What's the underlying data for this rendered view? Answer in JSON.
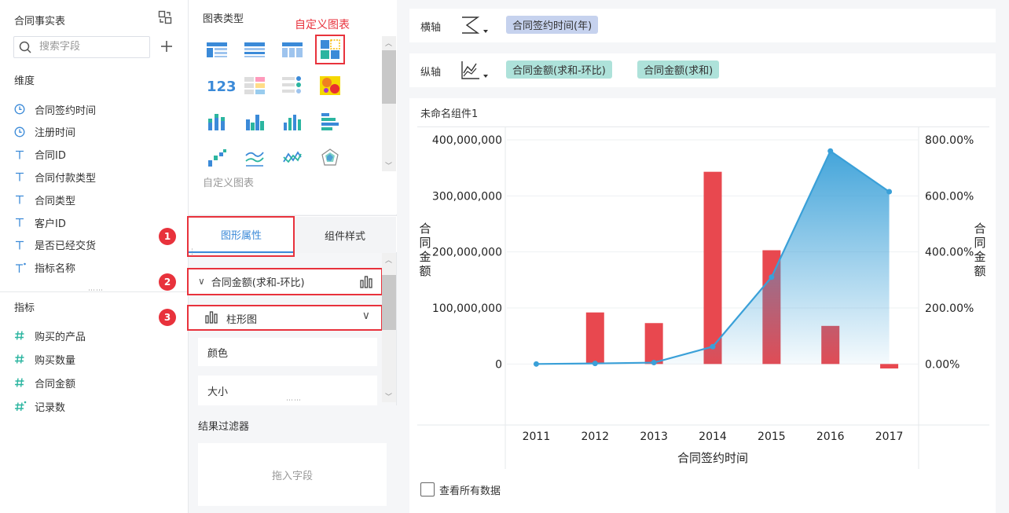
{
  "left_panel": {
    "dataset_title": "合同事实表",
    "search_placeholder": "搜索字段",
    "dimensions_label": "维度",
    "dimensions": [
      {
        "icon": "clock-icon",
        "label": "合同签约时间"
      },
      {
        "icon": "clock-icon",
        "label": "注册时间"
      },
      {
        "icon": "text-icon",
        "label": "合同ID"
      },
      {
        "icon": "text-icon",
        "label": "合同付款类型"
      },
      {
        "icon": "text-icon",
        "label": "合同类型"
      },
      {
        "icon": "text-icon",
        "label": "客户ID"
      },
      {
        "icon": "text-icon",
        "label": "是否已经交货"
      },
      {
        "icon": "text-calc-icon",
        "label": "指标名称"
      }
    ],
    "measures_label": "指标",
    "measures": [
      {
        "icon": "hash-icon",
        "label": "购买的产品"
      },
      {
        "icon": "hash-icon",
        "label": "购买数量"
      },
      {
        "icon": "hash-icon",
        "label": "合同金额"
      },
      {
        "icon": "hash-calc-icon",
        "label": "记录数"
      }
    ]
  },
  "middle_panel": {
    "chart_type_label": "图表类型",
    "custom_chart_callout": "自定义图表",
    "selected_footer": "自定义图表",
    "tabs": [
      {
        "label": "图形属性",
        "active": true
      },
      {
        "label": "组件样式",
        "active": false
      }
    ],
    "badges": [
      "1",
      "2",
      "3"
    ],
    "measure_row_label": "合同金额(求和-环比)",
    "chart_type_select": "柱形图",
    "props": [
      "颜色",
      "大小"
    ],
    "filter_title": "结果过滤器",
    "filter_placeholder": "拖入字段"
  },
  "axes": {
    "x_label": "横轴",
    "x_fields": [
      "合同签约时间(年)"
    ],
    "y_label": "纵轴",
    "y_fields": [
      "合同金额(求和-环比)",
      "合同金额(求和)"
    ]
  },
  "widget": {
    "title": "未命名组件1",
    "show_all_label": "查看所有数据"
  },
  "colors": {
    "bar": "#e8484f",
    "line": "#3aa0d8",
    "accent": "#3b8ad8",
    "highlight": "#e8323c"
  },
  "chart_data": {
    "type": "bar",
    "categories": [
      "2011",
      "2012",
      "2013",
      "2014",
      "2015",
      "2016",
      "2017"
    ],
    "xlabel": "合同签约时间",
    "ylabel_left": "合同金额",
    "ylabel_right": "合同金额",
    "y_left_ticks": [
      "400,000,000",
      "300,000,000",
      "200,000,000",
      "100,000,000",
      "0"
    ],
    "y_right_ticks": [
      "800.00%",
      "600.00%",
      "400.00%",
      "200.00%",
      "0.00%"
    ],
    "ylim_left": [
      0,
      400000000
    ],
    "ylim_right": [
      0,
      8
    ],
    "series": [
      {
        "name": "合同金额(求和)",
        "type": "bar",
        "values": [
          0,
          92000000,
          73000000,
          343000000,
          203000000,
          68000000,
          -8000000
        ]
      },
      {
        "name": "合同金额(求和-环比)",
        "type": "area",
        "values": [
          0.0,
          0.02,
          0.05,
          0.62,
          3.1,
          7.6,
          6.15
        ]
      }
    ],
    "grid": true,
    "legend": "none"
  }
}
